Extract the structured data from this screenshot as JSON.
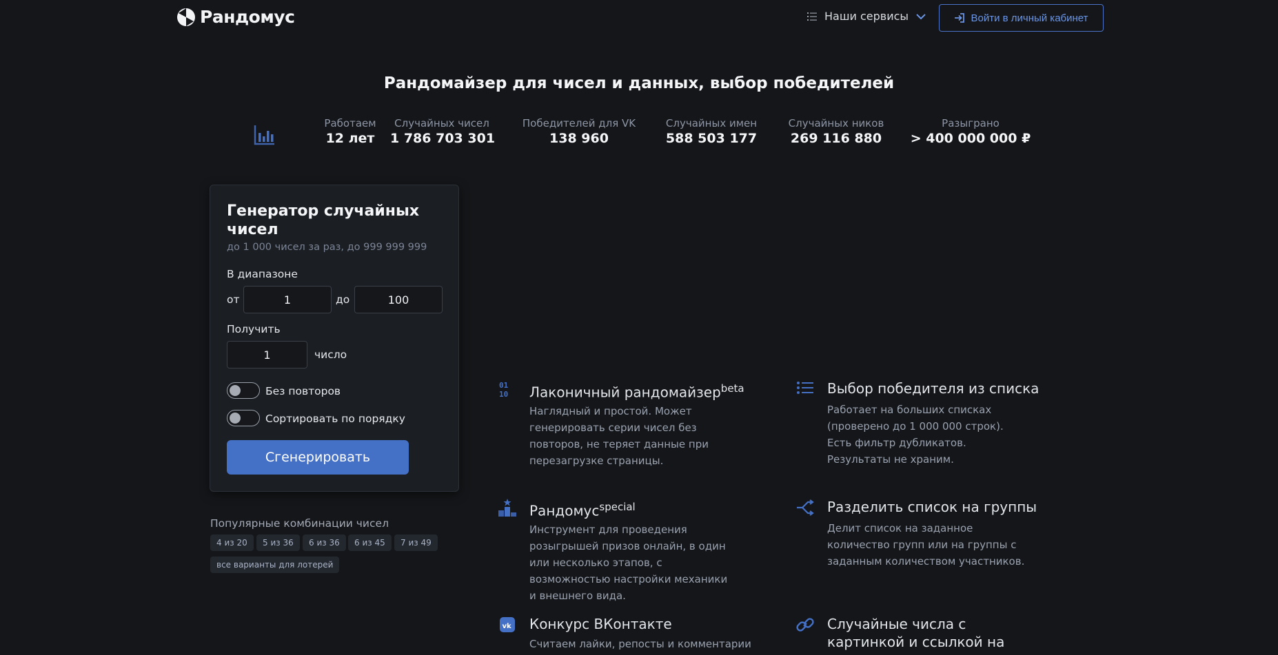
{
  "header": {
    "logo_text": "Рандомус",
    "services_label": "Наши сервисы",
    "login_label": "Войти в личный кабинет"
  },
  "title": "Рандомайзер для чисел и данных, выбор победителей",
  "stats": [
    {
      "label": "Работаем",
      "value": "12 лет"
    },
    {
      "label": "Случайных чисел",
      "value": "1 786 703 301"
    },
    {
      "label": "Победителей для VK",
      "value": "138 960"
    },
    {
      "label": "Случайных имен",
      "value": "588 503 177"
    },
    {
      "label": "Случайных ников",
      "value": "269 116 880"
    },
    {
      "label": "Разыграно",
      "value": "> 400 000 000 ₽"
    }
  ],
  "generator": {
    "title": "Генератор случайных чисел",
    "subtitle": "до 1 000 чисел за раз, до 999 999 999",
    "range_label": "В диапазоне",
    "from_label": "от",
    "from_value": "1",
    "to_label": "до",
    "to_value": "100",
    "get_label": "Получить",
    "count_value": "1",
    "count_unit": "число",
    "no_repeat_label": "Без повторов",
    "sort_label": "Сортировать по порядку",
    "button_label": "Сгенерировать"
  },
  "popular": {
    "title": "Популярные комбинации чисел",
    "chips": [
      "4 из 20",
      "5 из 36",
      "6 из 36",
      "6 из 45",
      "7 из 49",
      "все варианты для лотерей"
    ]
  },
  "features": [
    {
      "title": "Лаконичный рандомайзер",
      "sup": "beta",
      "desc": "Наглядный и простой. Может генерировать серии чисел без повторов, не теряет данные при перезагрузке страницы.",
      "icon": "binary-icon"
    },
    {
      "title": "Выбор победителя из списка",
      "sup": "",
      "desc": "Работает на больших списках (проверено до 1 000 000 строк). Есть фильтр дубликатов. Результаты не храним.",
      "icon": "list-icon"
    },
    {
      "title": "Рандомус",
      "sup": "special",
      "desc": "Инструмент для проведения розыгрышей призов онлайн, в один или несколько этапов, с возможностью настройки механики и внешнего вида.",
      "icon": "podium-icon"
    },
    {
      "title": "Разделить список на группы",
      "sup": "",
      "desc": "Делит список на заданное количество групп или на группы с заданным количеством участников.",
      "icon": "split-icon"
    },
    {
      "title": "Конкурс ВКонтакте",
      "sup": "",
      "desc": "Считаем лайки, репосты и комментарии",
      "icon": "vk-icon"
    },
    {
      "title": "Случайные числа с картинкой и ссылкой на результат",
      "sup": "",
      "desc": "",
      "icon": "link-icon"
    }
  ],
  "colors": {
    "accent": "#4470c6",
    "background": "#141619",
    "card": "#1b1e23"
  }
}
